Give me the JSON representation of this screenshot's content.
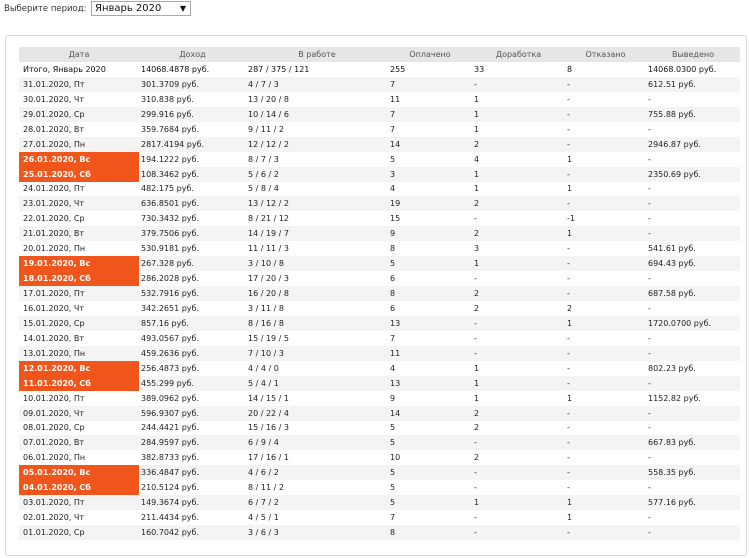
{
  "header": {
    "period_label": "Выберите период:",
    "period_value": "Январь 2020",
    "period_arrow": "▼"
  },
  "table": {
    "columns": [
      "Дата",
      "Доход",
      "В работе",
      "Оплачено",
      "Доработка",
      "Отказано",
      "Выведено"
    ],
    "total": {
      "date": "Итого, Январь 2020",
      "income": "14068.4878 руб.",
      "in_work": "287 / 375 / 121",
      "paid": "255",
      "rework": "33",
      "refused": "8",
      "withdrawn": "14068.0300 руб."
    },
    "rows": [
      {
        "date": "31.01.2020, Пт",
        "income": "301.3709 руб.",
        "in_work": "4 / 7 / 3",
        "paid": "7",
        "rework": "-",
        "refused": "-",
        "withdrawn": "612.51 руб.",
        "weekend": false
      },
      {
        "date": "30.01.2020, Чт",
        "income": "310.838 руб.",
        "in_work": "13 / 20 / 8",
        "paid": "11",
        "rework": "1",
        "refused": "-",
        "withdrawn": "-",
        "weekend": false
      },
      {
        "date": "29.01.2020, Ср",
        "income": "299.916 руб.",
        "in_work": "10 / 14 / 6",
        "paid": "7",
        "rework": "1",
        "refused": "-",
        "withdrawn": "755.88 руб.",
        "weekend": false
      },
      {
        "date": "28.01.2020, Вт",
        "income": "359.7684 руб.",
        "in_work": "9 / 11 / 2",
        "paid": "7",
        "rework": "1",
        "refused": "-",
        "withdrawn": "-",
        "weekend": false
      },
      {
        "date": "27.01.2020, Пн",
        "income": "2817.4194 руб.",
        "in_work": "12 / 12 / 2",
        "paid": "14",
        "rework": "2",
        "refused": "-",
        "withdrawn": "2946.87 руб.",
        "weekend": false
      },
      {
        "date": "26.01.2020, Вс",
        "income": "194.1222 руб.",
        "in_work": "8 / 7 / 3",
        "paid": "5",
        "rework": "4",
        "refused": "1",
        "withdrawn": "-",
        "weekend": true
      },
      {
        "date": "25.01.2020, Сб",
        "income": "108.3462 руб.",
        "in_work": "5 / 6 / 2",
        "paid": "3",
        "rework": "1",
        "refused": "-",
        "withdrawn": "2350.69 руб.",
        "weekend": true
      },
      {
        "date": "24.01.2020, Пт",
        "income": "482.175 руб.",
        "in_work": "5 / 8 / 4",
        "paid": "4",
        "rework": "1",
        "refused": "1",
        "withdrawn": "-",
        "weekend": false
      },
      {
        "date": "23.01.2020, Чт",
        "income": "636.8501 руб.",
        "in_work": "13 / 12 / 2",
        "paid": "19",
        "rework": "2",
        "refused": "-",
        "withdrawn": "-",
        "weekend": false
      },
      {
        "date": "22.01.2020, Ср",
        "income": "730.3432 руб.",
        "in_work": "8 / 21 / 12",
        "paid": "15",
        "rework": "-",
        "refused": "-1",
        "withdrawn": "-",
        "weekend": false
      },
      {
        "date": "21.01.2020, Вт",
        "income": "379.7506 руб.",
        "in_work": "14 / 19 / 7",
        "paid": "9",
        "rework": "2",
        "refused": "1",
        "withdrawn": "-",
        "weekend": false
      },
      {
        "date": "20.01.2020, Пн",
        "income": "530.9181 руб.",
        "in_work": "11 / 11 / 3",
        "paid": "8",
        "rework": "3",
        "refused": "-",
        "withdrawn": "541.61 руб.",
        "weekend": false
      },
      {
        "date": "19.01.2020, Вс",
        "income": "267.328 руб.",
        "in_work": "3 / 10 / 8",
        "paid": "5",
        "rework": "1",
        "refused": "-",
        "withdrawn": "694.43 руб.",
        "weekend": true
      },
      {
        "date": "18.01.2020, Сб",
        "income": "286.2028 руб.",
        "in_work": "17 / 20 / 3",
        "paid": "6",
        "rework": "-",
        "refused": "-",
        "withdrawn": "-",
        "weekend": true
      },
      {
        "date": "17.01.2020, Пт",
        "income": "532.7916 руб.",
        "in_work": "16 / 20 / 8",
        "paid": "8",
        "rework": "2",
        "refused": "-",
        "withdrawn": "687.58 руб.",
        "weekend": false
      },
      {
        "date": "16.01.2020, Чт",
        "income": "342.2651 руб.",
        "in_work": "3 / 11 / 8",
        "paid": "6",
        "rework": "2",
        "refused": "2",
        "withdrawn": "-",
        "weekend": false
      },
      {
        "date": "15.01.2020, Ср",
        "income": "857.16 руб.",
        "in_work": "8 / 16 / 8",
        "paid": "13",
        "rework": "-",
        "refused": "1",
        "withdrawn": "1720.0700 руб.",
        "weekend": false
      },
      {
        "date": "14.01.2020, Вт",
        "income": "493.0567 руб.",
        "in_work": "15 / 19 / 5",
        "paid": "7",
        "rework": "-",
        "refused": "-",
        "withdrawn": "-",
        "weekend": false
      },
      {
        "date": "13.01.2020, Пн",
        "income": "459.2636 руб.",
        "in_work": "7 / 10 / 3",
        "paid": "11",
        "rework": "-",
        "refused": "-",
        "withdrawn": "-",
        "weekend": false
      },
      {
        "date": "12.01.2020, Вс",
        "income": "256.4873 руб.",
        "in_work": "4 / 4 / 0",
        "paid": "4",
        "rework": "1",
        "refused": "-",
        "withdrawn": "802.23 руб.",
        "weekend": true
      },
      {
        "date": "11.01.2020, Сб",
        "income": "455.299 руб.",
        "in_work": "5 / 4 / 1",
        "paid": "13",
        "rework": "1",
        "refused": "-",
        "withdrawn": "-",
        "weekend": true
      },
      {
        "date": "10.01.2020, Пт",
        "income": "389.0962 руб.",
        "in_work": "14 / 15 / 1",
        "paid": "9",
        "rework": "1",
        "refused": "1",
        "withdrawn": "1152.82 руб.",
        "weekend": false
      },
      {
        "date": "09.01.2020, Чт",
        "income": "596.9307 руб.",
        "in_work": "20 / 22 / 4",
        "paid": "14",
        "rework": "2",
        "refused": "-",
        "withdrawn": "-",
        "weekend": false
      },
      {
        "date": "08.01.2020, Ср",
        "income": "244.4421 руб.",
        "in_work": "15 / 16 / 3",
        "paid": "5",
        "rework": "2",
        "refused": "-",
        "withdrawn": "-",
        "weekend": false
      },
      {
        "date": "07.01.2020, Вт",
        "income": "284.9597 руб.",
        "in_work": "6 / 9 / 4",
        "paid": "5",
        "rework": "-",
        "refused": "-",
        "withdrawn": "667.83 руб.",
        "weekend": false
      },
      {
        "date": "06.01.2020, Пн",
        "income": "382.8733 руб.",
        "in_work": "17 / 16 / 1",
        "paid": "10",
        "rework": "2",
        "refused": "-",
        "withdrawn": "-",
        "weekend": false
      },
      {
        "date": "05.01.2020, Вс",
        "income": "336.4847 руб.",
        "in_work": "4 / 6 / 2",
        "paid": "5",
        "rework": "-",
        "refused": "-",
        "withdrawn": "558.35 руб.",
        "weekend": true
      },
      {
        "date": "04.01.2020, Сб",
        "income": "210.5124 руб.",
        "in_work": "8 / 11 / 2",
        "paid": "5",
        "rework": "-",
        "refused": "-",
        "withdrawn": "-",
        "weekend": true
      },
      {
        "date": "03.01.2020, Пт",
        "income": "149.3674 руб.",
        "in_work": "6 / 7 / 2",
        "paid": "5",
        "rework": "1",
        "refused": "1",
        "withdrawn": "577.16 руб.",
        "weekend": false
      },
      {
        "date": "02.01.2020, Чт",
        "income": "211.4434 руб.",
        "in_work": "4 / 5 / 1",
        "paid": "7",
        "rework": "-",
        "refused": "1",
        "withdrawn": "-",
        "weekend": false
      },
      {
        "date": "01.01.2020, Ср",
        "income": "160.7042 руб.",
        "in_work": "3 / 6 / 3",
        "paid": "8",
        "rework": "-",
        "refused": "-",
        "withdrawn": "-",
        "weekend": false
      }
    ]
  },
  "colors": {
    "weekend_highlight": "#f0561c",
    "header_bg": "#e6e6e6"
  }
}
